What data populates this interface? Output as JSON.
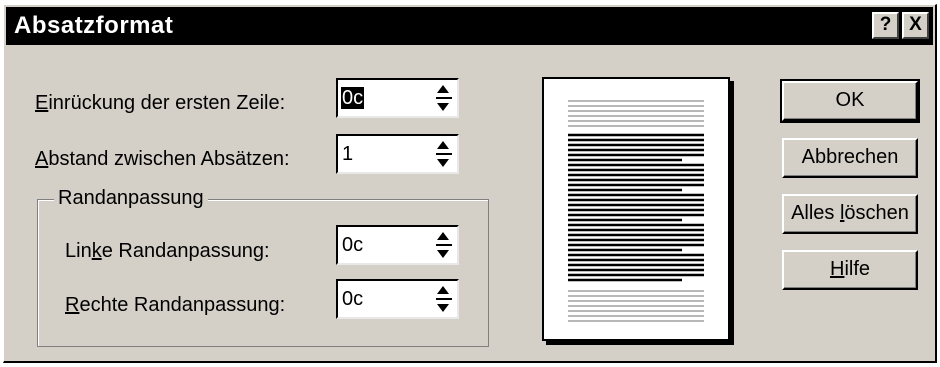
{
  "window": {
    "title": "Absatzformat",
    "help_button": "?",
    "close_button": "X"
  },
  "fields": {
    "first_line_indent": {
      "label_mnemonic": "E",
      "label_rest": "inrückung der ersten Zeile:",
      "value": "0c"
    },
    "paragraph_spacing": {
      "label_mnemonic": "A",
      "label_rest": "bstand zwischen Absätzen:",
      "value": "1"
    }
  },
  "margins_group": {
    "title": "Randanpassung",
    "left": {
      "label_pre": "Lin",
      "label_mnemonic": "k",
      "label_post": "e Randanpassung:",
      "value": "0c"
    },
    "right": {
      "label_mnemonic": "R",
      "label_rest": "echte Randanpassung:",
      "value": "0c"
    }
  },
  "buttons": {
    "ok": "OK",
    "cancel": "Abbrechen",
    "clear_all_pre": "Alles ",
    "clear_all_mnemonic": "l",
    "clear_all_post": "öschen",
    "help_mnemonic": "H",
    "help_rest": "ilfe"
  },
  "icons": {
    "spin": "spinner-arrows-icon",
    "preview": "page-preview-icon"
  },
  "colors": {
    "dialog_face": "#d4d0c8",
    "titlebar": "#000000",
    "title_text": "#ffffff",
    "selection": "#000000"
  }
}
